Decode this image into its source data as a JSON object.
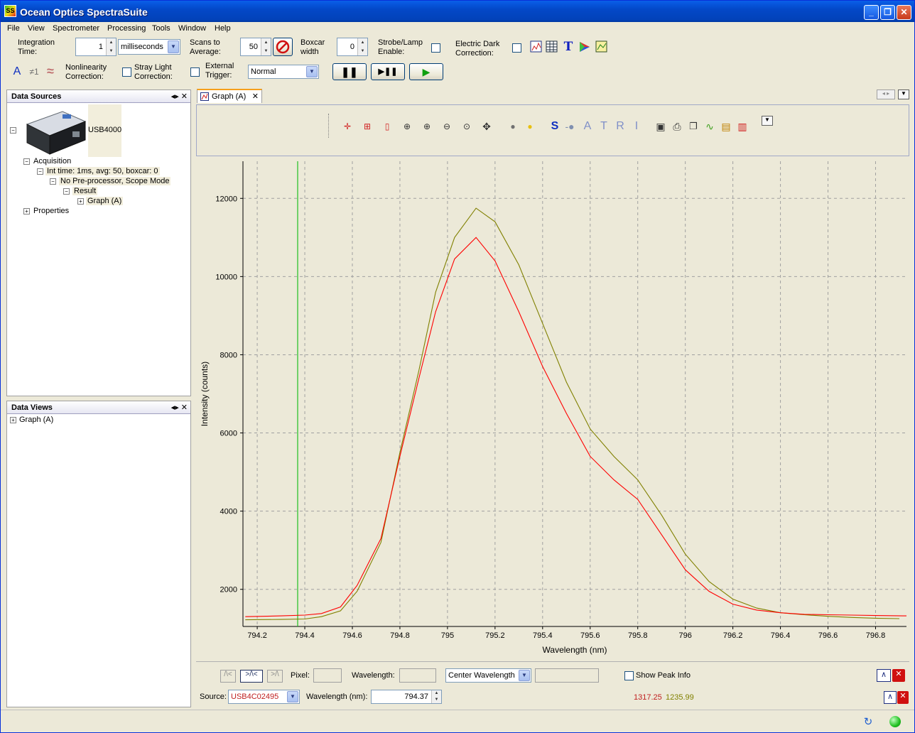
{
  "window": {
    "title": "Ocean Optics SpectraSuite",
    "app_icon_label": "SS"
  },
  "menu": [
    "File",
    "View",
    "Spectrometer",
    "Processing",
    "Tools",
    "Window",
    "Help"
  ],
  "toolbar": {
    "integration_time_label": "Integration Time:",
    "integration_value": "1",
    "integration_unit": "milliseconds",
    "scans_label": "Scans to Average:",
    "scans_value": "50",
    "boxcar_label": "Boxcar width",
    "boxcar_value": "0",
    "strobe_label": "Strobe/Lamp Enable:",
    "electric_dark_label": "Electric Dark Correction:",
    "nonlinearity_label": "Nonlinearity Correction:",
    "stray_light_label": "Stray Light Correction:",
    "external_trigger_label": "External Trigger:",
    "trigger_mode": "Normal",
    "glyph_a": "A",
    "glyph_ne1": "≠1",
    "glyph_tilde": "≈"
  },
  "data_sources": {
    "title": "Data Sources",
    "device": "USB4000",
    "acquisition": "Acquisition",
    "int_time": "Int time: 1ms, avg: 50, boxcar: 0",
    "preprocessor": "No Pre-processor, Scope Mode",
    "result": "Result",
    "graph": "Graph (A)",
    "properties": "Properties"
  },
  "data_views": {
    "title": "Data Views",
    "graph": "Graph (A)"
  },
  "graph_tab": {
    "label": "Graph (A)"
  },
  "graph_toolbar": {
    "letters": [
      "S",
      "A",
      "T",
      "R",
      "I"
    ]
  },
  "chart_data": {
    "type": "line",
    "xlabel": "Wavelength (nm)",
    "ylabel": "Intensity (counts)",
    "xlim": [
      794.14,
      796.93
    ],
    "ylim": [
      1050,
      12950
    ],
    "xticks": [
      794.2,
      794.4,
      794.6,
      794.8,
      795,
      795.2,
      795.4,
      795.6,
      795.8,
      796,
      796.2,
      796.4,
      796.6,
      796.8
    ],
    "xtick_labels": [
      "794.2",
      "794.4",
      "794.6",
      "794.8",
      "795",
      "795.2",
      "795.4",
      "795.6",
      "795.8",
      "796",
      "796.2",
      "796.4",
      "796.6",
      "796.8"
    ],
    "yticks": [
      2000,
      4000,
      6000,
      8000,
      10000,
      12000
    ],
    "ytick_labels": [
      "2000",
      "4000",
      "6000",
      "8000",
      "10000",
      "12000"
    ],
    "grid": true,
    "cursor_wavelength": 794.37,
    "series": [
      {
        "color": "#ff0000",
        "x": [
          794.15,
          794.3,
          794.4,
          794.47,
          794.55,
          794.62,
          794.72,
          794.8,
          794.88,
          794.95,
          795.03,
          795.12,
          795.2,
          795.3,
          795.4,
          795.5,
          795.6,
          795.7,
          795.8,
          795.9,
          796.0,
          796.1,
          796.2,
          796.3,
          796.4,
          796.5,
          796.6,
          796.7,
          796.8,
          796.93
        ],
        "y": [
          1300,
          1320,
          1340,
          1380,
          1550,
          2100,
          3300,
          5400,
          7400,
          9100,
          10450,
          11000,
          10400,
          9100,
          7700,
          6500,
          5400,
          4800,
          4300,
          3400,
          2500,
          1950,
          1620,
          1470,
          1400,
          1360,
          1350,
          1340,
          1330,
          1320
        ]
      },
      {
        "color": "#808000",
        "x": [
          794.15,
          794.3,
          794.4,
          794.47,
          794.55,
          794.62,
          794.72,
          794.8,
          794.88,
          794.95,
          795.03,
          795.12,
          795.2,
          795.3,
          795.4,
          795.5,
          795.6,
          795.7,
          795.8,
          795.9,
          796.0,
          796.1,
          796.2,
          796.3,
          796.4,
          796.5,
          796.6,
          796.7,
          796.8,
          796.9
        ],
        "y": [
          1220,
          1230,
          1240,
          1300,
          1450,
          1950,
          3200,
          5500,
          7600,
          9600,
          11000,
          11750,
          11400,
          10300,
          8800,
          7300,
          6100,
          5400,
          4800,
          3900,
          2900,
          2200,
          1750,
          1520,
          1400,
          1350,
          1310,
          1280,
          1260,
          1250
        ]
      }
    ]
  },
  "bottom": {
    "pixel_label": "Pixel:",
    "wavelength_label": "Wavelength:",
    "center_wavelength": "Center Wavelength",
    "show_peak_info": "Show Peak Info",
    "source_label": "Source:",
    "source_value": "USB4C02495",
    "wavelength_nm_label": "Wavelength (nm):",
    "wavelength_nm_value": "794.37",
    "readout_red": "1317.25",
    "readout_olive": "1235.99"
  }
}
